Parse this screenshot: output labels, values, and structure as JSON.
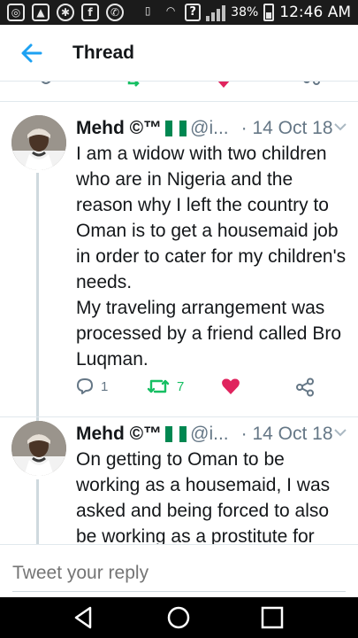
{
  "status_bar": {
    "battery": "38%",
    "time": "12:46 AM",
    "icons": [
      "chrome-icon",
      "gallery-icon",
      "settings-icon",
      "facebook-icon",
      "whatsapp-icon",
      "vibrate-icon",
      "wifi-icon",
      "unknown-icon",
      "signal-icon",
      "battery-icon"
    ]
  },
  "header": {
    "title": "Thread",
    "back_icon": "arrow-left-icon"
  },
  "tweets": [
    {
      "name": "Mehd ©™",
      "handle": "@i...",
      "date": "· 14 Oct 18",
      "text": "I am a widow with two children who are in Nigeria and the reason why I left the country to Oman is to get a housemaid job in order to cater for my children's needs.\nMy traveling arrangement was processed by a friend called Bro Luqman.",
      "replies": "1",
      "retweets": "7"
    },
    {
      "name": "Mehd ©™",
      "handle": "@i...",
      "date": "· 14 Oct 18",
      "text": "On getting to Oman to be working as a housemaid, I was asked and being forced to also be working as a prostitute for"
    }
  ],
  "reply": {
    "placeholder": "Tweet your reply"
  },
  "colors": {
    "accent": "#1da1f2",
    "retweet": "#17bf63",
    "like": "#e0245e",
    "muted": "#657786",
    "nigeria_green": "#008751"
  }
}
